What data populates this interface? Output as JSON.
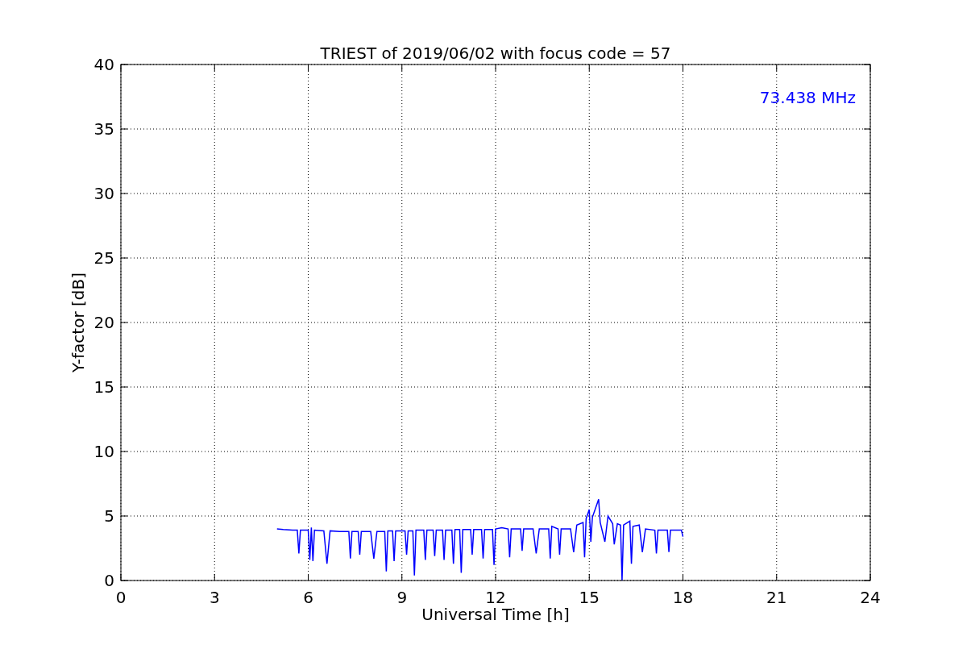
{
  "figure": {
    "chart_data": {
      "type": "line",
      "title": "TRIEST of 2019/06/02 with focus code = 57",
      "xlabel": "Universal Time [h]",
      "ylabel": "Y-factor [dB]",
      "xlim": [
        0,
        24
      ],
      "ylim": [
        0,
        40
      ],
      "grid": true,
      "xticks": [
        0,
        3,
        6,
        9,
        12,
        15,
        18,
        21,
        24
      ],
      "yticks": [
        0,
        5,
        10,
        15,
        20,
        25,
        30,
        35,
        40
      ],
      "annotations": [
        "73.438 MHz"
      ],
      "x": [
        5.0,
        5.2,
        5.5,
        5.65,
        5.7,
        5.75,
        6.0,
        6.05,
        6.1,
        6.15,
        6.2,
        6.5,
        6.6,
        6.7,
        7.0,
        7.3,
        7.35,
        7.4,
        7.6,
        7.65,
        7.7,
        8.0,
        8.1,
        8.2,
        8.45,
        8.5,
        8.55,
        8.7,
        8.75,
        8.8,
        9.1,
        9.15,
        9.2,
        9.35,
        9.4,
        9.45,
        9.7,
        9.75,
        9.8,
        10.0,
        10.05,
        10.1,
        10.3,
        10.35,
        10.4,
        10.6,
        10.65,
        10.7,
        10.85,
        10.9,
        10.95,
        11.2,
        11.25,
        11.3,
        11.55,
        11.6,
        11.65,
        11.9,
        11.95,
        12.0,
        12.2,
        12.4,
        12.45,
        12.5,
        12.8,
        12.85,
        12.9,
        13.2,
        13.3,
        13.4,
        13.7,
        13.75,
        13.8,
        14.0,
        14.05,
        14.1,
        14.4,
        14.5,
        14.6,
        14.8,
        14.85,
        14.9,
        15.0,
        15.05,
        15.1,
        15.3,
        15.35,
        15.5,
        15.6,
        15.75,
        15.8,
        15.9,
        16.0,
        16.05,
        16.1,
        16.3,
        16.35,
        16.4,
        16.6,
        16.7,
        16.8,
        17.1,
        17.15,
        17.2,
        17.5,
        17.55,
        17.6,
        17.95,
        18.0
      ],
      "series": [
        {
          "color": "#0000ff",
          "values": [
            4.0,
            3.95,
            3.9,
            3.9,
            2.1,
            3.9,
            3.9,
            1.6,
            4.1,
            1.5,
            3.9,
            3.85,
            1.3,
            3.85,
            3.8,
            3.8,
            1.7,
            3.8,
            3.8,
            2.0,
            3.8,
            3.8,
            1.7,
            3.8,
            3.8,
            0.7,
            3.85,
            3.85,
            1.5,
            3.85,
            3.85,
            2.0,
            3.85,
            3.85,
            0.4,
            3.9,
            3.9,
            1.6,
            3.9,
            3.9,
            1.9,
            3.9,
            3.9,
            1.6,
            3.9,
            3.9,
            1.3,
            3.95,
            3.95,
            0.6,
            3.95,
            3.95,
            2.0,
            3.95,
            3.95,
            1.7,
            3.95,
            3.95,
            1.2,
            4.0,
            4.1,
            4.0,
            1.8,
            4.0,
            4.0,
            2.3,
            4.0,
            4.0,
            2.1,
            4.0,
            4.0,
            1.7,
            4.2,
            4.0,
            2.0,
            4.0,
            4.0,
            2.2,
            4.3,
            4.5,
            1.8,
            4.8,
            5.5,
            3.0,
            4.9,
            6.3,
            4.5,
            3.0,
            5.0,
            4.4,
            2.8,
            4.4,
            4.3,
            0.0,
            4.3,
            4.6,
            1.3,
            4.2,
            4.3,
            2.2,
            4.0,
            3.9,
            2.1,
            3.9,
            3.9,
            2.2,
            3.9,
            3.9,
            3.4
          ]
        }
      ]
    }
  }
}
